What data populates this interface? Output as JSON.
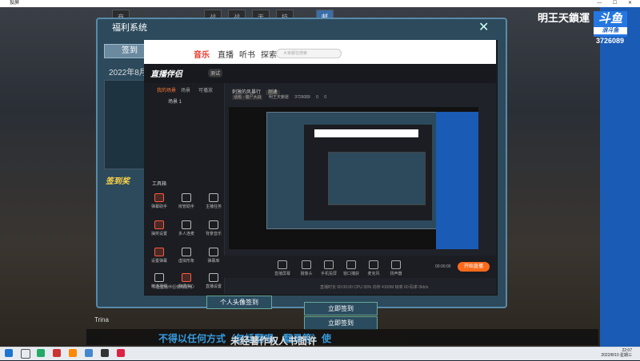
{
  "window": {
    "title": "投屏",
    "controls": "— ☐ ✕"
  },
  "game": {
    "logo": "明王天鎖運",
    "douyu_logo": "斗鱼",
    "douyu_sub": "浪斗鱼",
    "room_id": "3726089",
    "menu": [
      "商城",
      "战令",
      "战队",
      "天赋",
      "技能",
      "邮箱活动"
    ],
    "welfare_title": "福利系统",
    "checkin_tab": "签到",
    "date": "2022年8月",
    "checkin_reward": "签到奖",
    "lower_buttons": [
      "个人头像签到",
      "立即签到",
      "立即签到"
    ],
    "player_label": "Trina"
  },
  "ticker": {
    "pre": "未经著作权人书面许可，",
    "hl": "不得以任何方式（包括翻唱、翻录等）使"
  },
  "app": {
    "tabs": [
      "音乐",
      "直播",
      "听书",
      "探索"
    ],
    "search_placeholder": "大家都在搜索",
    "brand": "直播伴侣",
    "version": "测试",
    "left_tabs": [
      "我的场景",
      "场景",
      "可播放"
    ],
    "scene_name": "场景 1",
    "preview_title": "刺激的风暴行",
    "preview_badge": "测速",
    "preview_meta": [
      "话题 · 僵尸大战",
      "明王天鎖運",
      "3726089",
      "0",
      "0"
    ],
    "tools_title": "工具箱",
    "tools": [
      "弹幕助手",
      "房管助手",
      "主播任务",
      "抽奖设置",
      "多人连麦",
      "背景音乐",
      "设置弹幕",
      "虚拟形象",
      "弹幕库",
      "精选视频",
      "数据中心",
      "直播设置"
    ],
    "toolbar": [
      "直播屏幕",
      "摄像头",
      "手机投屏",
      "窗口捕获",
      "麦克风",
      "扬声器"
    ],
    "golive": "开始直播",
    "status": "直播时长 00:00:00  CPU 30%  内存 4100M  帧率 60  码率 0kb/s",
    "footer": "斗鱼直播伴侣使用说明",
    "timer": "00:00:00"
  },
  "taskbar": {
    "time": "22:07",
    "date": "2022/8/10 星期三"
  }
}
